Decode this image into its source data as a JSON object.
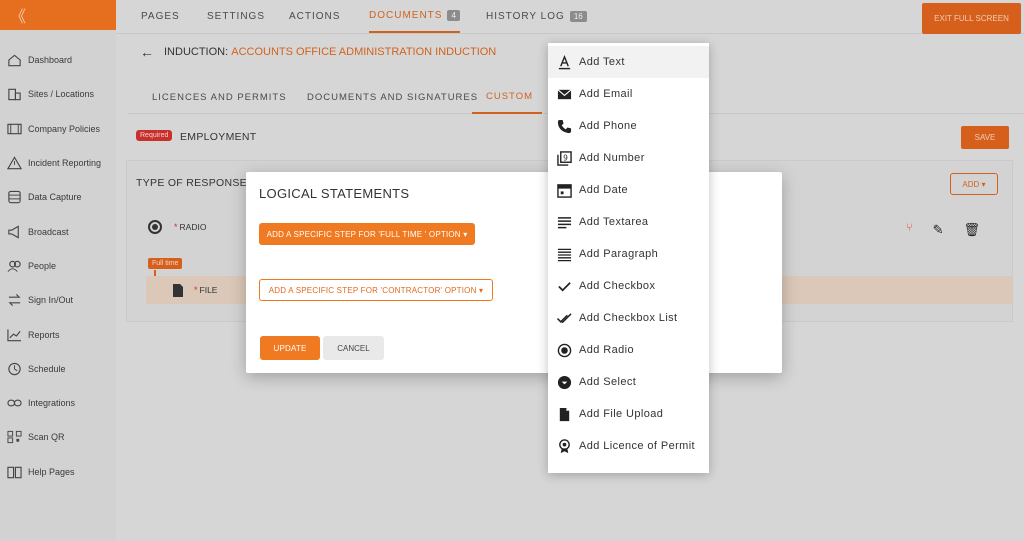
{
  "sidebar": {
    "toggle_glyph": "《",
    "items": [
      {
        "label": "Dashboard",
        "icon": "home-icon"
      },
      {
        "label": "Sites / Locations",
        "icon": "building-icon"
      },
      {
        "label": "Company Policies",
        "icon": "book-icon"
      },
      {
        "label": "Incident Reporting",
        "icon": "warning-icon"
      },
      {
        "label": "Data Capture",
        "icon": "database-icon"
      },
      {
        "label": "Broadcast",
        "icon": "megaphone-icon"
      },
      {
        "label": "People",
        "icon": "people-icon"
      },
      {
        "label": "Sign In/Out",
        "icon": "swap-icon"
      },
      {
        "label": "Reports",
        "icon": "chart-icon"
      },
      {
        "label": "Schedule",
        "icon": "clock-icon"
      },
      {
        "label": "Integrations",
        "icon": "link-icon"
      },
      {
        "label": "Scan QR",
        "icon": "qr-icon"
      },
      {
        "label": "Help Pages",
        "icon": "help-book-icon"
      }
    ]
  },
  "topnav": {
    "tabs": [
      {
        "label": "PAGES"
      },
      {
        "label": "SETTINGS"
      },
      {
        "label": "ACTIONS"
      },
      {
        "label": "DOCUMENTS",
        "badge": "4",
        "active": true
      },
      {
        "label": "HISTORY LOG",
        "badge": "16"
      }
    ],
    "exit_label": "EXIT FULL SCREEN"
  },
  "breadcrumb": {
    "prefix": "INDUCTION:",
    "value": "ACCOUNTS OFFICE ADMINISTRATION INDUCTION"
  },
  "subtabs": [
    {
      "label": "LICENCES AND PERMITS"
    },
    {
      "label": "DOCUMENTS AND SIGNATURES"
    },
    {
      "label": "CUSTOM",
      "active": true
    }
  ],
  "section": {
    "required_badge": "Required",
    "title": "EMPLOYMENT",
    "save_label": "SAVE",
    "type_of_response": "TYPE OF RESPONSE",
    "add_label": "ADD",
    "radio_label": "RADIO",
    "required_mark": "*",
    "fulltime_badge": "Full time",
    "file_label": "FILE"
  },
  "modal": {
    "title": "LOGICAL STATEMENTS",
    "option1_label": "ADD A SPECIFIC STEP FOR 'FULL TIME ' OPTION",
    "option2_label": "ADD A SPECIFIC STEP FOR 'CONTRACTOR' OPTION",
    "update_label": "UPDATE",
    "cancel_label": "CANCEL"
  },
  "menu": {
    "items": [
      {
        "label": "Add Text",
        "icon": "text-icon"
      },
      {
        "label": "Add Email",
        "icon": "email-icon"
      },
      {
        "label": "Add Phone",
        "icon": "phone-icon"
      },
      {
        "label": "Add Number",
        "icon": "number-icon"
      },
      {
        "label": "Add Date",
        "icon": "calendar-icon"
      },
      {
        "label": "Add Textarea",
        "icon": "textarea-icon"
      },
      {
        "label": "Add Paragraph",
        "icon": "paragraph-icon"
      },
      {
        "label": "Add Checkbox",
        "icon": "check-icon"
      },
      {
        "label": "Add Checkbox List",
        "icon": "double-check-icon"
      },
      {
        "label": "Add Radio",
        "icon": "radio-icon"
      },
      {
        "label": "Add Select",
        "icon": "select-icon"
      },
      {
        "label": "Add File Upload",
        "icon": "file-icon"
      },
      {
        "label": "Add Licence of Permit",
        "icon": "licence-icon"
      }
    ]
  },
  "colors": {
    "accent": "#f07a21",
    "accent_dark": "#d1621e",
    "required": "#c9302c"
  }
}
